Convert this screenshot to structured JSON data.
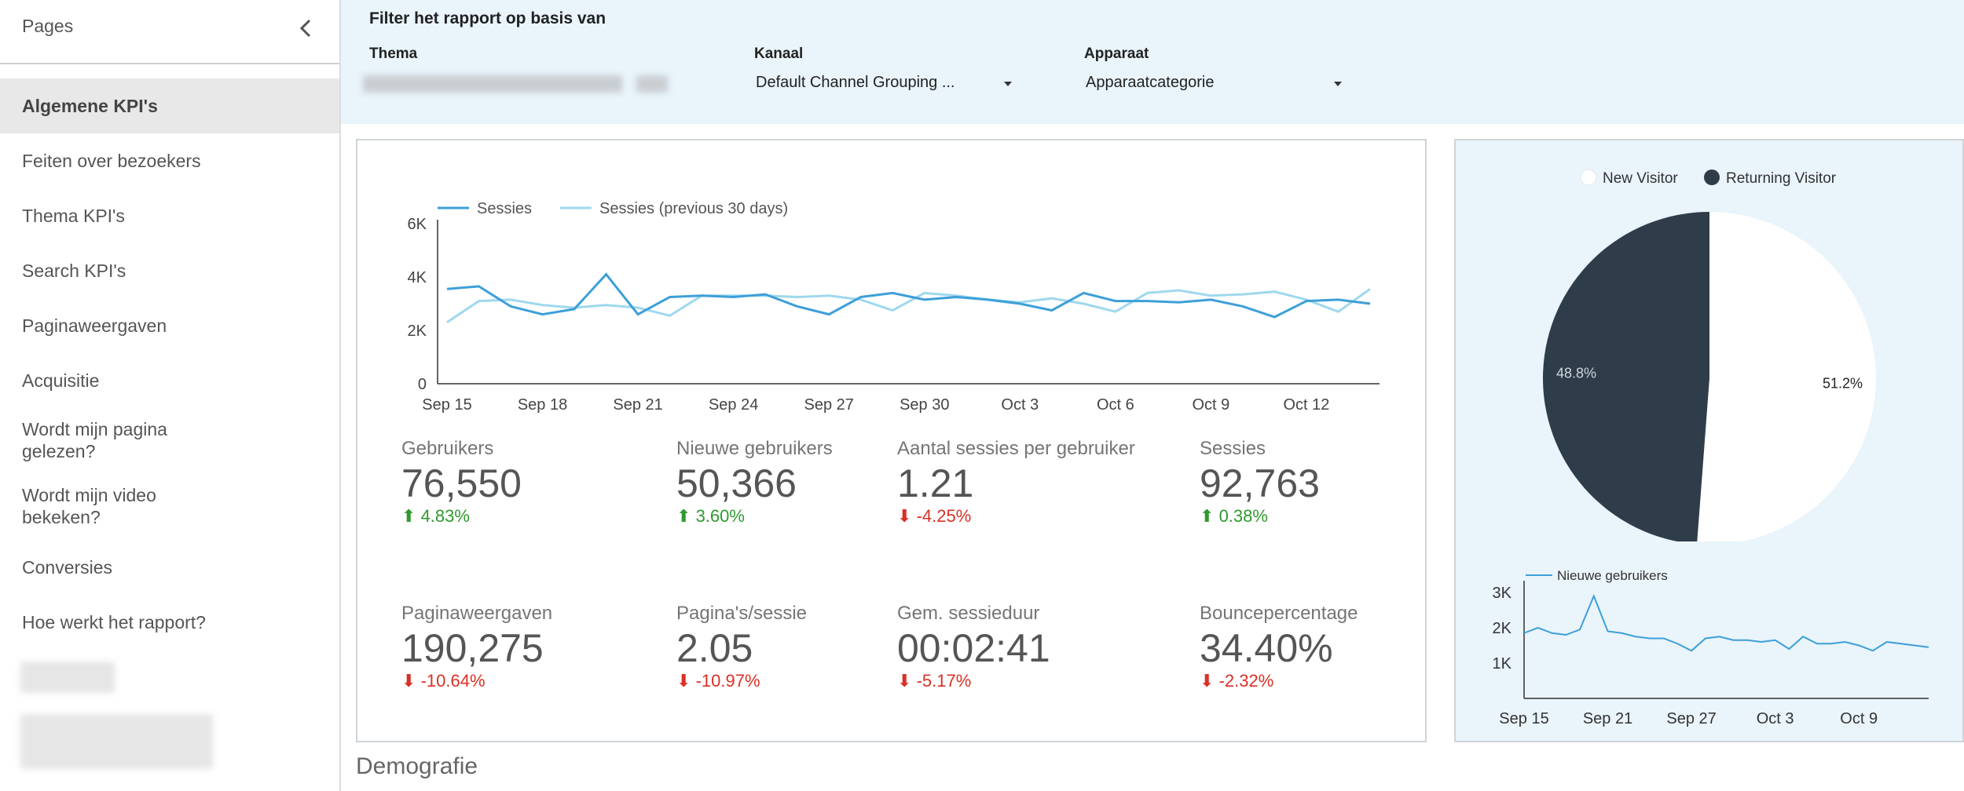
{
  "sidebar": {
    "title": "Pages",
    "items": [
      {
        "label": "Algemene KPI's",
        "active": true
      },
      {
        "label": "Feiten over bezoekers"
      },
      {
        "label": "Thema KPI's"
      },
      {
        "label": "Search KPI's"
      },
      {
        "label": "Paginaweergaven"
      },
      {
        "label": "Acquisitie"
      },
      {
        "label": "Wordt mijn pagina gelezen?"
      },
      {
        "label": "Wordt mijn video bekeken?"
      },
      {
        "label": "Conversies"
      },
      {
        "label": "Hoe werkt het rapport?"
      }
    ]
  },
  "filters": {
    "title": "Filter het rapport op basis van",
    "thema": {
      "label": "Thema"
    },
    "kanaal": {
      "label": "Kanaal",
      "value": "Default Channel Grouping ..."
    },
    "apparaat": {
      "label": "Apparaat",
      "value": "Apparaatcategorie"
    }
  },
  "kpis": [
    {
      "label": "Gebruikers",
      "value": "76,550",
      "delta": "4.83%",
      "direction": "up"
    },
    {
      "label": "Nieuwe gebruikers",
      "value": "50,366",
      "delta": "3.60%",
      "direction": "up"
    },
    {
      "label": "Aantal sessies per gebruiker",
      "value": "1.21",
      "delta": "-4.25%",
      "direction": "down"
    },
    {
      "label": "Sessies",
      "value": "92,763",
      "delta": "0.38%",
      "direction": "up"
    },
    {
      "label": "Paginaweergaven",
      "value": "190,275",
      "delta": "-10.64%",
      "direction": "down"
    },
    {
      "label": "Pagina's/sessie",
      "value": "2.05",
      "delta": "-10.97%",
      "direction": "down"
    },
    {
      "label": "Gem. sessieduur",
      "value": "00:02:41",
      "delta": "-5.17%",
      "direction": "down"
    },
    {
      "label": "Bouncepercentage",
      "value": "34.40%",
      "delta": "-2.32%",
      "direction": "down"
    }
  ],
  "section_title": "Demografie",
  "colors": {
    "sessies": "#3d9fd8",
    "sessies_prev": "#9fd8ee",
    "returning": "#2f3c4a",
    "new": "#ffffff",
    "up": "#2e9a2e",
    "down": "#d93025",
    "filter_bg": "#e9f4fb"
  },
  "chart_data": [
    {
      "type": "line",
      "x": [
        "Sep 15",
        "Sep 16",
        "Sep 17",
        "Sep 18",
        "Sep 19",
        "Sep 20",
        "Sep 21",
        "Sep 22",
        "Sep 23",
        "Sep 24",
        "Sep 25",
        "Sep 26",
        "Sep 27",
        "Sep 28",
        "Sep 29",
        "Sep 30",
        "Oct 1",
        "Oct 2",
        "Oct 3",
        "Oct 4",
        "Oct 5",
        "Oct 6",
        "Oct 7",
        "Oct 8",
        "Oct 9",
        "Oct 10",
        "Oct 11",
        "Oct 12",
        "Oct 13",
        "Oct 14"
      ],
      "x_tick_labels": [
        "Sep 15",
        "Sep 18",
        "Sep 21",
        "Sep 24",
        "Sep 27",
        "Sep 30",
        "Oct 3",
        "Oct 6",
        "Oct 9",
        "Oct 12"
      ],
      "y_tick_labels": [
        "0",
        "2K",
        "4K",
        "6K"
      ],
      "ylim": [
        0,
        6000
      ],
      "legend": "top-left",
      "grid": false,
      "series": [
        {
          "name": "Sessies",
          "values": [
            3550,
            3650,
            2900,
            2600,
            2800,
            4100,
            2600,
            3250,
            3300,
            3250,
            3350,
            2900,
            2600,
            3250,
            3400,
            3150,
            3250,
            3150,
            3000,
            2750,
            3400,
            3100,
            3100,
            3050,
            3150,
            2900,
            2500,
            3100,
            3150,
            3000
          ]
        },
        {
          "name": "Sessies (previous 30 days)",
          "values": [
            2300,
            3100,
            3150,
            2950,
            2850,
            2950,
            2850,
            2550,
            3300,
            3300,
            3300,
            3250,
            3300,
            3150,
            2750,
            3400,
            3300,
            3150,
            3050,
            3200,
            3000,
            2700,
            3400,
            3500,
            3300,
            3350,
            3450,
            3150,
            2700,
            3550
          ]
        }
      ]
    },
    {
      "type": "pie",
      "legend": "top-center",
      "slices": [
        {
          "name": "New Visitor",
          "value": 51.2,
          "label": "51.2%"
        },
        {
          "name": "Returning Visitor",
          "value": 48.8,
          "label": "48.8%"
        }
      ]
    },
    {
      "type": "line",
      "x": [
        "Sep 15",
        "Sep 16",
        "Sep 17",
        "Sep 18",
        "Sep 19",
        "Sep 20",
        "Sep 21",
        "Sep 22",
        "Sep 23",
        "Sep 24",
        "Sep 25",
        "Sep 26",
        "Sep 27",
        "Sep 28",
        "Sep 29",
        "Sep 30",
        "Oct 1",
        "Oct 2",
        "Oct 3",
        "Oct 4",
        "Oct 5",
        "Oct 6",
        "Oct 7",
        "Oct 8",
        "Oct 9",
        "Oct 10",
        "Oct 11",
        "Oct 12",
        "Oct 13",
        "Oct 14"
      ],
      "x_tick_labels": [
        "Sep 15",
        "Sep 21",
        "Sep 27",
        "Oct 3",
        "Oct 9"
      ],
      "y_tick_labels": [
        "1K",
        "2K",
        "3K"
      ],
      "ylim": [
        0,
        3000
      ],
      "legend": "top-left",
      "grid": false,
      "series": [
        {
          "name": "Nieuwe gebruikers",
          "values": [
            1850,
            2000,
            1850,
            1800,
            1950,
            2900,
            1900,
            1850,
            1750,
            1700,
            1700,
            1550,
            1350,
            1700,
            1750,
            1650,
            1650,
            1600,
            1650,
            1400,
            1750,
            1550,
            1550,
            1600,
            1500,
            1350,
            1600,
            1550,
            1500,
            1450
          ]
        }
      ]
    }
  ]
}
